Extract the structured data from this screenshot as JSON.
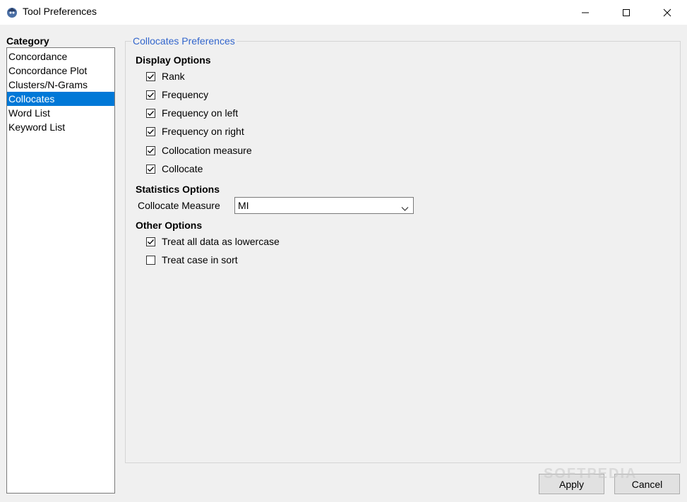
{
  "window": {
    "title": "Tool Preferences",
    "icon": "app-logo-icon",
    "controls": [
      "minimize-icon",
      "maximize-icon",
      "close-icon"
    ]
  },
  "category": {
    "label": "Category",
    "items": [
      {
        "label": "Concordance",
        "selected": false
      },
      {
        "label": "Concordance Plot",
        "selected": false
      },
      {
        "label": "Clusters/N-Grams",
        "selected": false
      },
      {
        "label": "Collocates",
        "selected": true
      },
      {
        "label": "Word List",
        "selected": false
      },
      {
        "label": "Keyword List",
        "selected": false
      }
    ]
  },
  "preferences": {
    "title": "Collocates Preferences",
    "display_options": {
      "title": "Display Options",
      "items": [
        {
          "label": "Rank",
          "checked": true
        },
        {
          "label": "Frequency",
          "checked": true
        },
        {
          "label": "Frequency on left",
          "checked": true
        },
        {
          "label": "Frequency on right",
          "checked": true
        },
        {
          "label": "Collocation measure",
          "checked": true
        },
        {
          "label": "Collocate",
          "checked": true
        }
      ]
    },
    "statistics_options": {
      "title": "Statistics Options",
      "measure_label": "Collocate Measure",
      "measure_value": "MI"
    },
    "other_options": {
      "title": "Other Options",
      "items": [
        {
          "label": "Treat all data as lowercase",
          "checked": true
        },
        {
          "label": "Treat case in sort",
          "checked": false
        }
      ]
    }
  },
  "buttons": {
    "apply": "Apply",
    "cancel": "Cancel"
  },
  "watermark": "SOFTPEDIA",
  "colors": {
    "selection": "#0078d7",
    "group_title": "#3366cc",
    "background": "#f0f0f0"
  }
}
